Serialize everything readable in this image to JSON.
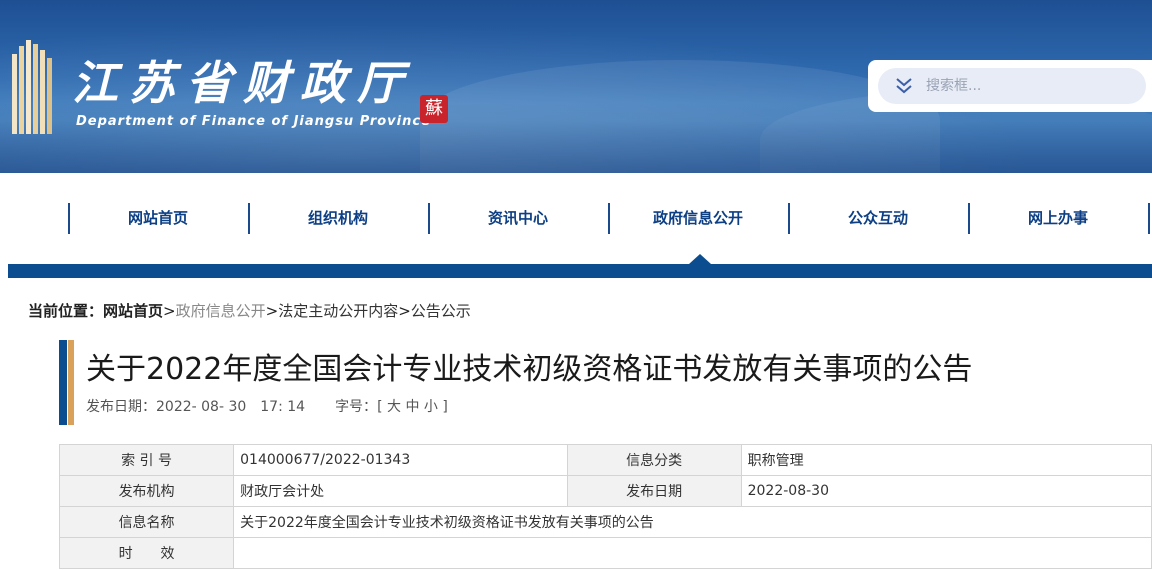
{
  "header": {
    "site_title": "江苏省财政厅",
    "site_subtitle": "Department of Finance of Jiangsu Province",
    "seal_text": "蘇",
    "search_placeholder": "搜索框..."
  },
  "nav": {
    "items": [
      {
        "label": "网站首页"
      },
      {
        "label": "组织机构"
      },
      {
        "label": "资讯中心"
      },
      {
        "label": "政府信息公开",
        "active": true
      },
      {
        "label": "公众互动"
      },
      {
        "label": "网上办事"
      }
    ]
  },
  "breadcrumb": {
    "prefix": "当前位置：",
    "items": [
      "网站首页",
      "政府信息公开",
      "法定主动公开内容",
      "公告公示"
    ],
    "separator": ">"
  },
  "article": {
    "title": "关于2022年度全国会计专业技术初级资格证书发放有关事项的公告",
    "date_label": "发布日期：",
    "date_value": "2022- 08- 30　17: 14",
    "font_label": "字号：",
    "font_open": "[",
    "font_large": "大",
    "font_medium": "中",
    "font_small": "小",
    "font_close": "]"
  },
  "info_table": {
    "index_label": "索 引 号",
    "index_value": "014000677/2022-01343",
    "category_label": "信息分类",
    "category_value": "职称管理",
    "publisher_label": "发布机构",
    "publisher_value": "财政厅会计处",
    "pub_date_label": "发布日期",
    "pub_date_value": "2022-08-30",
    "name_label": "信息名称",
    "name_value": "关于2022年度全国会计专业技术初级资格证书发放有关事项的公告",
    "validity_label": "时　　效",
    "validity_value": ""
  },
  "colors": {
    "brand_blue": "#0c4d8f",
    "nav_text": "#0d3f85",
    "accent_gold": "#d9a15a",
    "seal_red": "#c9232b"
  }
}
